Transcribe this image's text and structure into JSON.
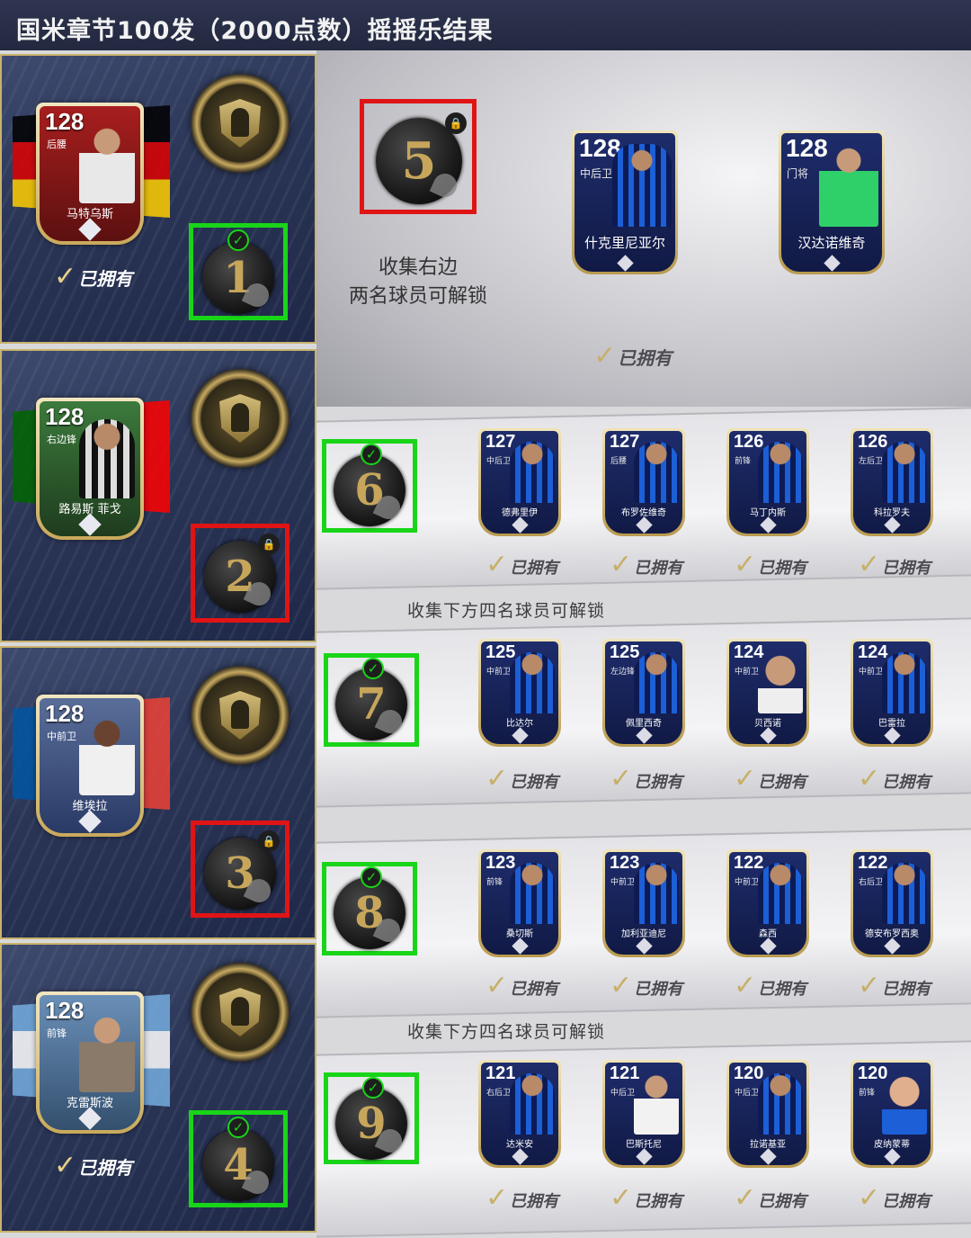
{
  "header": {
    "title": "国米章节100发（2000点数）摇摇乐结果"
  },
  "owned_label": "已拥有",
  "left_panels": [
    {
      "piece": "1",
      "status": "unlocked",
      "owned": true,
      "card": {
        "rating": "128",
        "position": "后腰",
        "name": "马特乌斯",
        "flag": [
          "#000000",
          "#dd0000",
          "#ffce00"
        ]
      }
    },
    {
      "piece": "2",
      "status": "locked",
      "owned": false,
      "card": {
        "rating": "128",
        "position": "右边锋",
        "name": "路易斯 菲戈",
        "flag": [
          "#006600",
          "#ff0000"
        ]
      }
    },
    {
      "piece": "3",
      "status": "locked",
      "owned": false,
      "card": {
        "rating": "128",
        "position": "中前卫",
        "name": "维埃拉",
        "flag": [
          "#0055a4",
          "#ffffff",
          "#ef4135"
        ]
      }
    },
    {
      "piece": "4",
      "status": "unlocked",
      "owned": true,
      "card": {
        "rating": "128",
        "position": "前锋",
        "name": "克雷斯波",
        "flag": [
          "#74acdf",
          "#ffffff",
          "#74acdf"
        ]
      }
    }
  ],
  "top_reward": {
    "piece": "5",
    "status": "locked",
    "unlock_text_line1": "收集右边",
    "unlock_text_line2": "两名球员可解锁",
    "owned": true,
    "cards": [
      {
        "rating": "128",
        "position": "中后卫",
        "name": "什克里尼亚尔"
      },
      {
        "rating": "128",
        "position": "门将",
        "name": "汉达诺维奇"
      }
    ]
  },
  "section_label": "收集下方四名球员可解锁",
  "rows": [
    {
      "piece": "6",
      "status": "unlocked",
      "cards": [
        {
          "rating": "127",
          "position": "中后卫",
          "name": "德弗里伊"
        },
        {
          "rating": "127",
          "position": "后腰",
          "name": "布罗佐维奇"
        },
        {
          "rating": "126",
          "position": "前锋",
          "name": "马丁内斯"
        },
        {
          "rating": "126",
          "position": "左后卫",
          "name": "科拉罗夫"
        }
      ]
    },
    {
      "piece": "7",
      "status": "unlocked",
      "cards": [
        {
          "rating": "125",
          "position": "中前卫",
          "name": "比达尔"
        },
        {
          "rating": "125",
          "position": "左边锋",
          "name": "佩里西奇"
        },
        {
          "rating": "124",
          "position": "中前卫",
          "name": "贝西诺"
        },
        {
          "rating": "124",
          "position": "中前卫",
          "name": "巴雷拉"
        }
      ]
    },
    {
      "piece": "8",
      "status": "unlocked",
      "cards": [
        {
          "rating": "123",
          "position": "前锋",
          "name": "桑切斯"
        },
        {
          "rating": "123",
          "position": "中前卫",
          "name": "加利亚迪尼"
        },
        {
          "rating": "122",
          "position": "中前卫",
          "name": "森西"
        },
        {
          "rating": "122",
          "position": "右后卫",
          "name": "德安布罗西奥"
        }
      ]
    },
    {
      "piece": "9",
      "status": "unlocked",
      "cards": [
        {
          "rating": "121",
          "position": "右后卫",
          "name": "达米安"
        },
        {
          "rating": "121",
          "position": "中后卫",
          "name": "巴斯托尼"
        },
        {
          "rating": "120",
          "position": "中后卫",
          "name": "拉诺基亚"
        },
        {
          "rating": "120",
          "position": "前锋",
          "name": "皮纳蒙蒂"
        }
      ]
    }
  ],
  "colors": {
    "unlocked_box": "#19d519",
    "locked_box": "#e01414",
    "gold": "#c9b26a"
  },
  "icons": {
    "check": "✓",
    "lock": "lock-icon"
  }
}
